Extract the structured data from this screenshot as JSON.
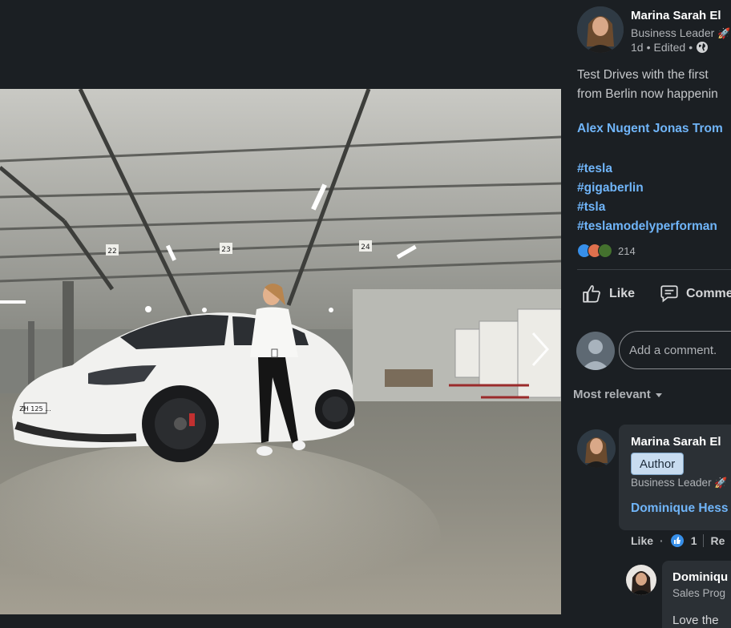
{
  "post": {
    "author_name": "Marina Sarah El",
    "author_headline": "Business Leader",
    "meta_time": "1d",
    "meta_edited": "Edited",
    "meta_separator": "•",
    "text_line1": "Test Drives with the first",
    "text_line2": "from Berlin now happenin",
    "mentions": "Alex Nugent Jonas Trom",
    "hashtags": [
      "#tesla",
      "#gigaberlin",
      "#tsla",
      "#teslamodelyperforman"
    ],
    "reaction_count": "214"
  },
  "photo": {
    "bay_numbers": [
      "22",
      "23",
      "24"
    ],
    "license_plate": "ZH 125 ..."
  },
  "actions": {
    "like_label": "Like",
    "comment_label": "Comme"
  },
  "comment_input": {
    "placeholder": "Add a comment."
  },
  "sort": {
    "label": "Most relevant"
  },
  "comment": {
    "name": "Marina Sarah El",
    "badge": "Author",
    "headline": "Business Leader",
    "mention": "Dominique Hess",
    "like_label": "Like",
    "dot": "·",
    "like_count": "1",
    "reply_label": "Re"
  },
  "reply": {
    "name": "Dominiqu",
    "headline": "Sales Prog",
    "text": "Love the"
  },
  "colors": {
    "background": "#1b1f23",
    "link": "#70b5f9",
    "card": "#2b3035"
  },
  "icons": {
    "globe": "globe-icon",
    "like": "thumbs-up-icon",
    "comment": "comment-icon",
    "chevron": "chevron-down-icon",
    "next": "chevron-right-icon"
  }
}
